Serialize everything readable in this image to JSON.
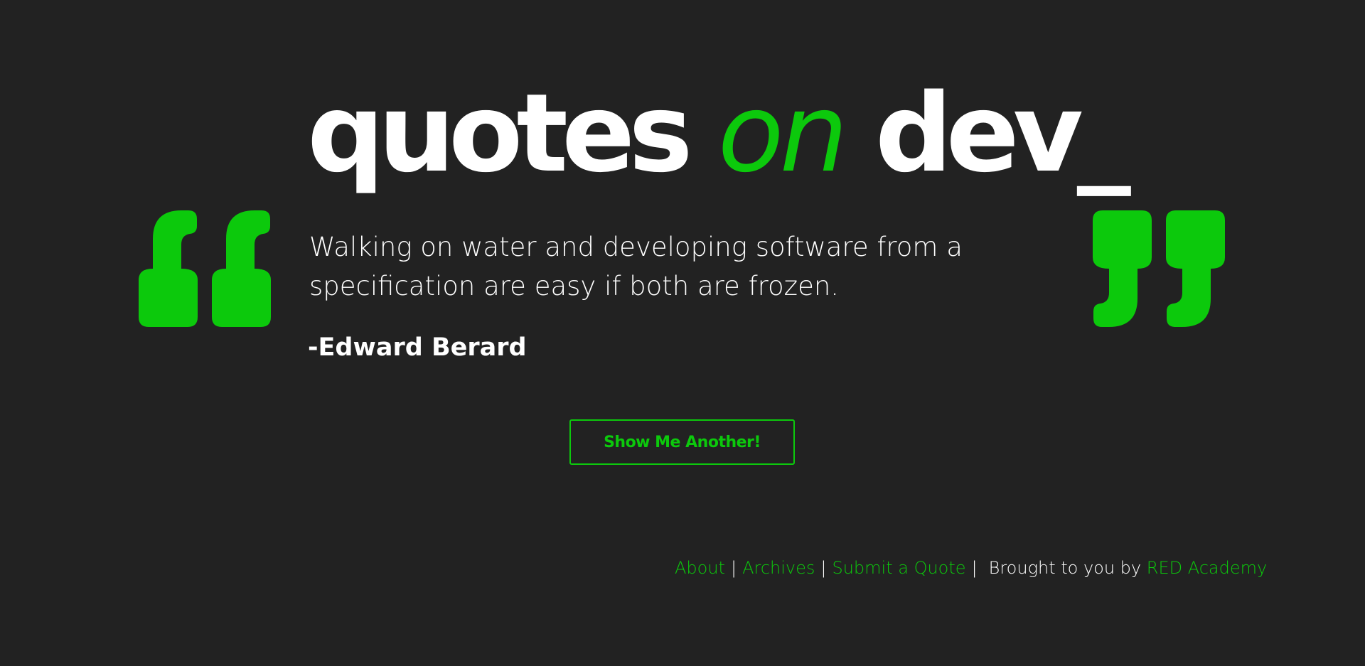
{
  "header": {
    "title_part1": "quotes",
    "title_part2": "on",
    "title_part3": "dev_"
  },
  "quote": {
    "text": "Walking on water and developing software from a specification are easy if both are frozen.",
    "author": "-Edward Berard"
  },
  "actions": {
    "show_another_label": "Show Me Another!"
  },
  "footer": {
    "links": [
      {
        "label": "About"
      },
      {
        "label": "Archives"
      },
      {
        "label": "Submit a Quote"
      }
    ],
    "separator": "|",
    "credit_prefix": "Brought to you by",
    "credit_link": "RED Academy"
  },
  "icons": {
    "open_quote": "open-quote-icon",
    "close_quote": "close-quote-icon"
  },
  "colors": {
    "background": "#222222",
    "accent": "#0cc90c",
    "text": "#ffffff"
  }
}
